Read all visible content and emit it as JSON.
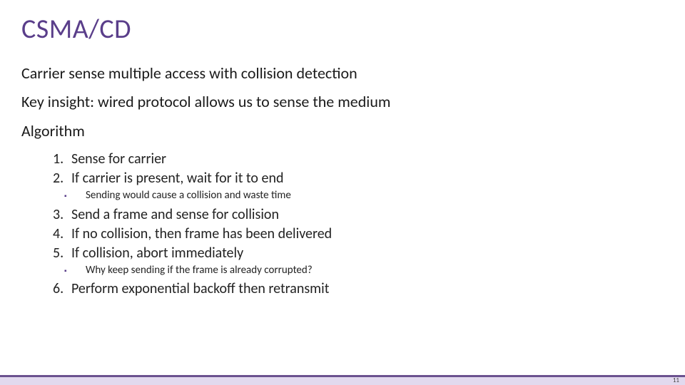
{
  "title": "CSMA/CD",
  "lines": {
    "l1": "Carrier sense multiple access with collision detection",
    "l2": "Key insight: wired protocol allows us to sense the medium",
    "l3": "Algorithm"
  },
  "steps": {
    "s1": "Sense for carrier",
    "s2": "If carrier is present, wait for it to end",
    "s2a": "Sending would cause a collision and waste time",
    "s3": "Send a frame and sense for collision",
    "s4": "If no collision, then frame has been delivered",
    "s5": "If collision, abort immediately",
    "s5a": "Why keep sending if the frame is already corrupted?",
    "s6": "Perform exponential backoff then retransmit"
  },
  "nums": {
    "n1": "1.",
    "n2": "2.",
    "n3": "3.",
    "n4": "4.",
    "n5": "5.",
    "n6": "6."
  },
  "page": "11"
}
